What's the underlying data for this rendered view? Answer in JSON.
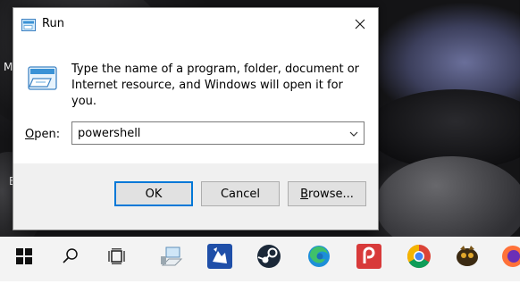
{
  "dialog": {
    "title": "Run",
    "description": "Type the name of a program, folder, document or Internet resource, and Windows will open it for you.",
    "open_label": "Open:",
    "open_label_mnemonic": "O",
    "open_label_rest": "pen:",
    "input_value": "powershell",
    "buttons": {
      "ok": "OK",
      "cancel": "Cancel",
      "browse": "Browse...",
      "browse_mnemonic": "B",
      "browse_rest": "rowse..."
    }
  },
  "desktop": {
    "partial_labels": [
      "M",
      "E"
    ]
  },
  "taskbar": {
    "icons": [
      "start-icon",
      "search-icon",
      "task-view-icon",
      "network-pc-icon",
      "app-icon",
      "steam-icon",
      "edge-icon",
      "pocketcasts-icon",
      "chrome-icon",
      "browser-icon",
      "firefox-icon"
    ]
  },
  "colors": {
    "accent": "#0078d7",
    "dialog_bg": "#f0f0f0",
    "taskbar_bg": "#f3f3f3"
  }
}
